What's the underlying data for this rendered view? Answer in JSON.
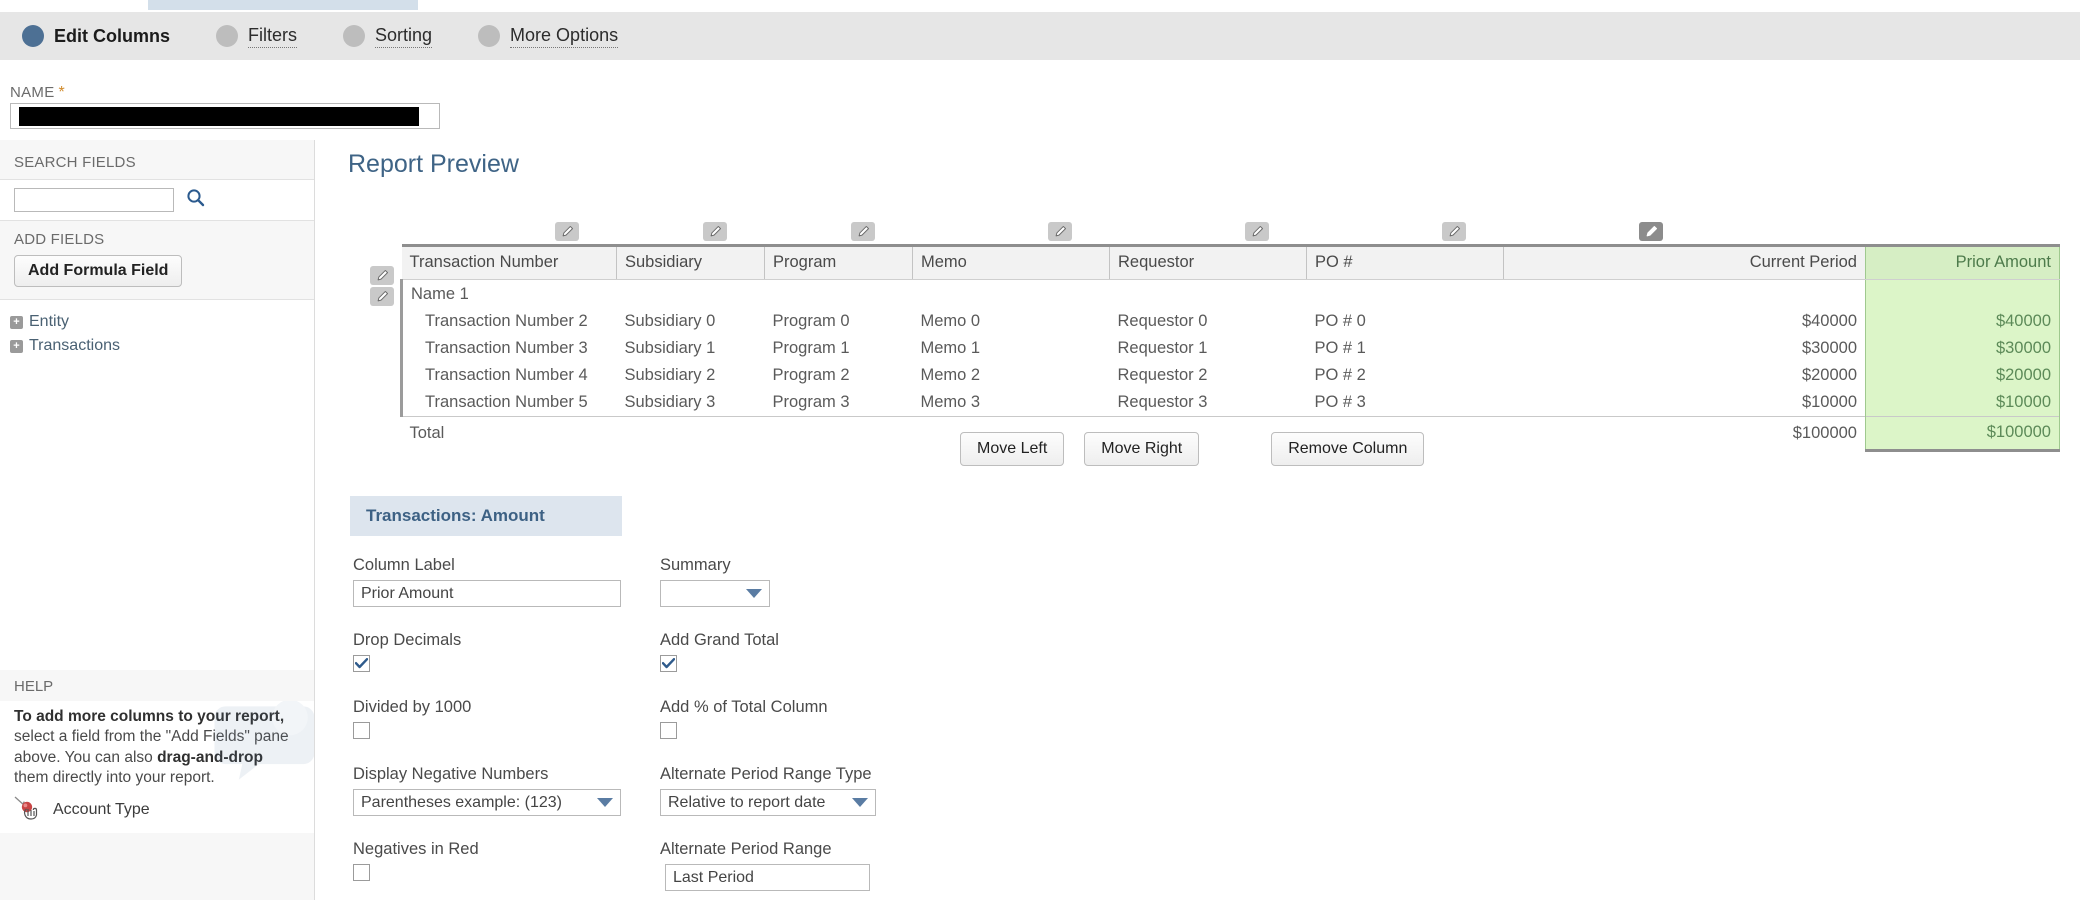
{
  "tabs": [
    {
      "label": "Edit Columns",
      "active": true
    },
    {
      "label": "Filters",
      "active": false
    },
    {
      "label": "Sorting",
      "active": false
    },
    {
      "label": "More Options",
      "active": false
    }
  ],
  "name_field": {
    "label": "NAME",
    "required_mark": "*",
    "value": ""
  },
  "sidebar": {
    "search_fields_title": "SEARCH FIELDS",
    "search_value": "",
    "search_icon": "search-icon",
    "add_fields_title": "ADD FIELDS",
    "add_formula_button": "Add Formula Field",
    "tree": [
      {
        "label": "Entity",
        "expander": "+"
      },
      {
        "label": "Transactions",
        "expander": "+"
      }
    ],
    "help": {
      "title": "HELP",
      "bold_lead": "To add more columns to your report,",
      "text_1": " select a field from the \"Add Fields\" pane above. You can also ",
      "bold_mid": "drag-and-drop",
      "text_2": " them directly into your report.",
      "drag_item": "Account Type"
    }
  },
  "main": {
    "preview_title": "Report Preview",
    "table": {
      "columns": [
        {
          "label": "Transaction Number",
          "align": "left",
          "editable": false,
          "highlight": false
        },
        {
          "label": "Subsidiary",
          "align": "left",
          "editable": true,
          "highlight": false
        },
        {
          "label": "Program",
          "align": "left",
          "editable": true,
          "highlight": false
        },
        {
          "label": "Memo",
          "align": "left",
          "editable": true,
          "highlight": false
        },
        {
          "label": "Requestor",
          "align": "left",
          "editable": true,
          "highlight": false
        },
        {
          "label": "PO #",
          "align": "left",
          "editable": true,
          "highlight": false
        },
        {
          "label": "Current Period",
          "align": "right",
          "editable": true,
          "highlight": false
        },
        {
          "label": "Prior Amount",
          "align": "right",
          "editable": true,
          "highlight": true
        }
      ],
      "group_row": "Name 1",
      "rows": [
        [
          "Transaction Number 2",
          "Subsidiary 0",
          "Program 0",
          "Memo 0",
          "Requestor 0",
          "PO # 0",
          "$40000",
          "$40000"
        ],
        [
          "Transaction Number 3",
          "Subsidiary 1",
          "Program 1",
          "Memo 1",
          "Requestor 1",
          "PO # 1",
          "$30000",
          "$30000"
        ],
        [
          "Transaction Number 4",
          "Subsidiary 2",
          "Program 2",
          "Memo 2",
          "Requestor 2",
          "PO # 2",
          "$20000",
          "$20000"
        ],
        [
          "Transaction Number 5",
          "Subsidiary 3",
          "Program 3",
          "Memo 3",
          "Requestor 3",
          "PO # 3",
          "$10000",
          "$10000"
        ]
      ],
      "total_row": [
        "Total",
        "",
        "",
        "",
        "",
        "",
        "$100000",
        "$100000"
      ]
    },
    "buttons": {
      "move_left": "Move Left",
      "move_right": "Move Right",
      "remove_column": "Remove Column"
    },
    "form": {
      "header": "Transactions: Amount",
      "column_label": {
        "label": "Column Label",
        "value": "Prior Amount"
      },
      "summary": {
        "label": "Summary",
        "value": ""
      },
      "drop_decimals": {
        "label": "Drop Decimals",
        "checked": true
      },
      "add_grand_total": {
        "label": "Add Grand Total",
        "checked": true
      },
      "divided_by_1000": {
        "label": "Divided by 1000",
        "checked": false
      },
      "add_pct_total": {
        "label": "Add % of Total Column",
        "checked": false
      },
      "display_negative": {
        "label": "Display Negative Numbers",
        "value": "Parentheses  example: (123)"
      },
      "alt_period_type": {
        "label": "Alternate Period Range Type",
        "value": "Relative to report date"
      },
      "negatives_red": {
        "label": "Negatives in Red",
        "checked": false
      },
      "alt_period_range": {
        "label": "Alternate Period Range",
        "value": "Last Period"
      }
    }
  },
  "colors": {
    "accent_blue": "#4d7094",
    "highlight_green_body": "#dcf5c8",
    "highlight_green_header": "#d6eec4",
    "panel_header_blue": "#dde5ee",
    "tabbar_gray": "#e6e6e6"
  }
}
